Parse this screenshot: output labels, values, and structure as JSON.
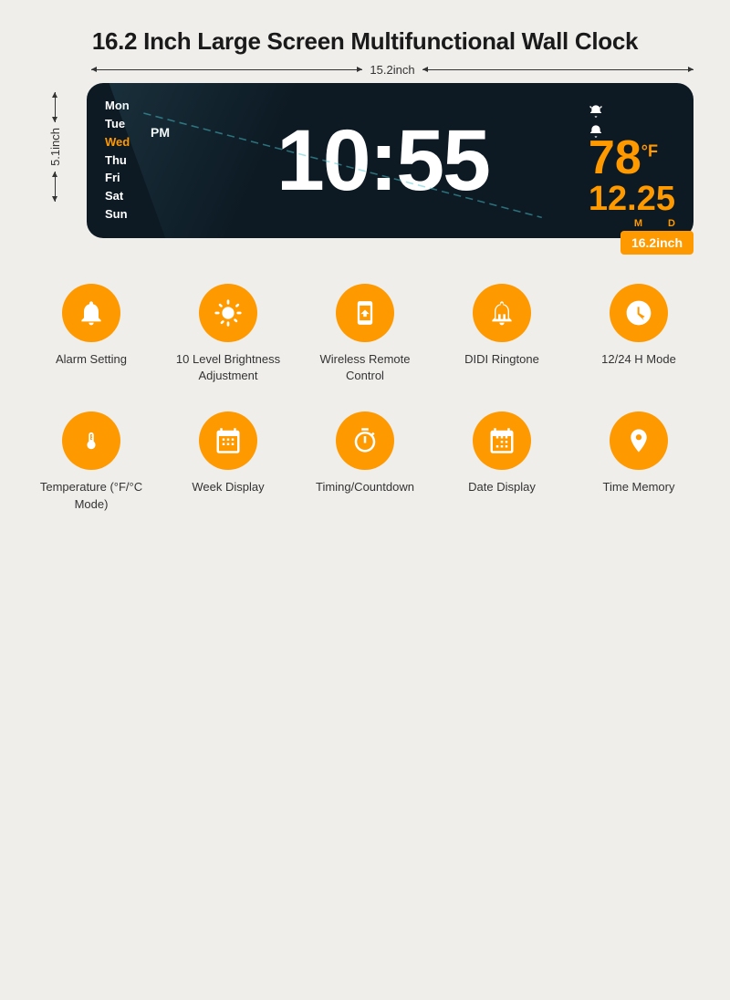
{
  "page": {
    "title": "16.2 Inch Large Screen Multifunctional Wall Clock"
  },
  "clock": {
    "days": [
      {
        "label": "Mon",
        "active": false
      },
      {
        "label": "Tue",
        "active": false
      },
      {
        "label": "Wed",
        "active": true
      },
      {
        "label": "Thu",
        "active": false
      },
      {
        "label": "Fri",
        "active": false
      },
      {
        "label": "Sat",
        "active": false
      },
      {
        "label": "Sun",
        "active": false
      }
    ],
    "ampm": "PM",
    "time": "10:55",
    "temperature": "78",
    "temp_unit": "°F",
    "date": "12.25",
    "date_labels": [
      "M",
      "D"
    ],
    "size_badge": "16.2inch",
    "dim_width": "15.2inch",
    "dim_height": "5.1inch"
  },
  "features": {
    "row1": [
      {
        "label": "Alarm Setting",
        "icon": "alarm"
      },
      {
        "label": "10 Level Brightness Adjustment",
        "icon": "brightness"
      },
      {
        "label": "Wireless Remote Control",
        "icon": "remote"
      },
      {
        "label": "DIDI Ringtone",
        "icon": "bell"
      },
      {
        "label": "12/24 H Mode",
        "icon": "clock24"
      }
    ],
    "row2": [
      {
        "label": "Temperature (°F/°C  Mode)",
        "icon": "thermometer"
      },
      {
        "label": "Week Display",
        "icon": "calendar-week"
      },
      {
        "label": "Timing/Countdown",
        "icon": "stopwatch"
      },
      {
        "label": "Date Display",
        "icon": "calendar-date"
      },
      {
        "label": "Time Memory",
        "icon": "time-memory"
      }
    ]
  }
}
